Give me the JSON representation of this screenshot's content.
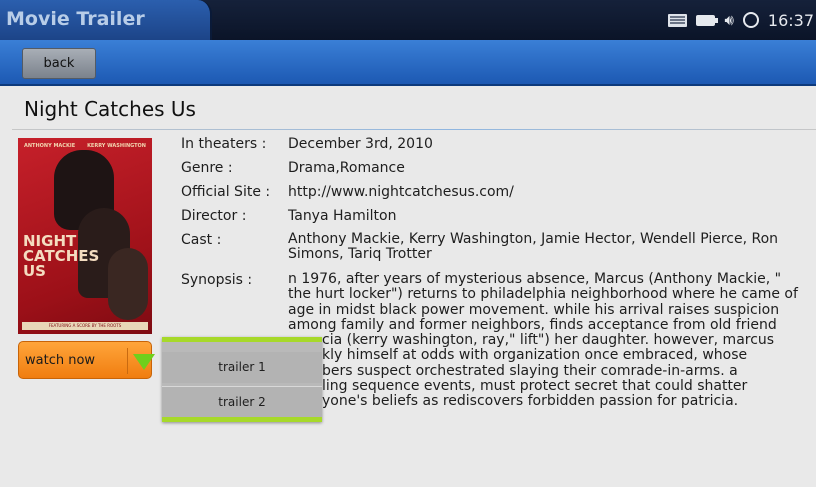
{
  "app": {
    "title": "Movie Trailer"
  },
  "status": {
    "time": "16:37",
    "icons": [
      "keyboard-icon",
      "battery-icon",
      "volume-icon",
      "sync-icon"
    ]
  },
  "toolbar": {
    "back_label": "back"
  },
  "movie": {
    "title": "Night Catches Us",
    "fields": [
      {
        "label": "In theaters :",
        "value": "December 3rd, 2010"
      },
      {
        "label": "Genre :",
        "value": "Drama,Romance"
      },
      {
        "label": "Official Site :",
        "value": "http://www.nightcatchesus.com/"
      },
      {
        "label": "Director :",
        "value": "Tanya Hamilton"
      },
      {
        "label": "Cast :",
        "value": "Anthony Mackie, Kerry Washington, Jamie Hector, Wendell Pierce, Ron Simons, Tariq Trotter"
      },
      {
        "label": "Synopsis :",
        "lines": [
          "n 1976, after years of mysterious absence, Marcus (Anthony Mackie, \"",
          "the hurt locker\") returns to philadelphia neighborhood where he came of",
          "age in midst black power movement. while his arrival raises suspicion",
          "among family and former neighbors, finds acceptance from old friend",
          "cia (kerry washington, ray,\" lift\") her daughter. however, marcus",
          "kly himself at odds with organization once embraced, whose",
          "bers suspect orchestrated slaying their comrade-in-arms. a",
          "ling sequence events, must protect secret that could shatter",
          "yone's beliefs as rediscovers forbidden passion for patricia."
        ]
      }
    ],
    "poster": {
      "actor_left": "ANTHONY MACKIE",
      "actor_right": "KERRY WASHINGTON",
      "title_lines": [
        "NIGHT",
        "CATCHES",
        "US"
      ],
      "strip": "FEATURING A SCORE BY THE ROOTS"
    }
  },
  "watch": {
    "label": "watch now"
  },
  "trailers": [
    "trailer 1",
    "trailer 2"
  ],
  "colors": {
    "accent_orange": "#f07d10",
    "accent_green": "#a7d92a",
    "toolbar_blue": "#1d59b3"
  }
}
